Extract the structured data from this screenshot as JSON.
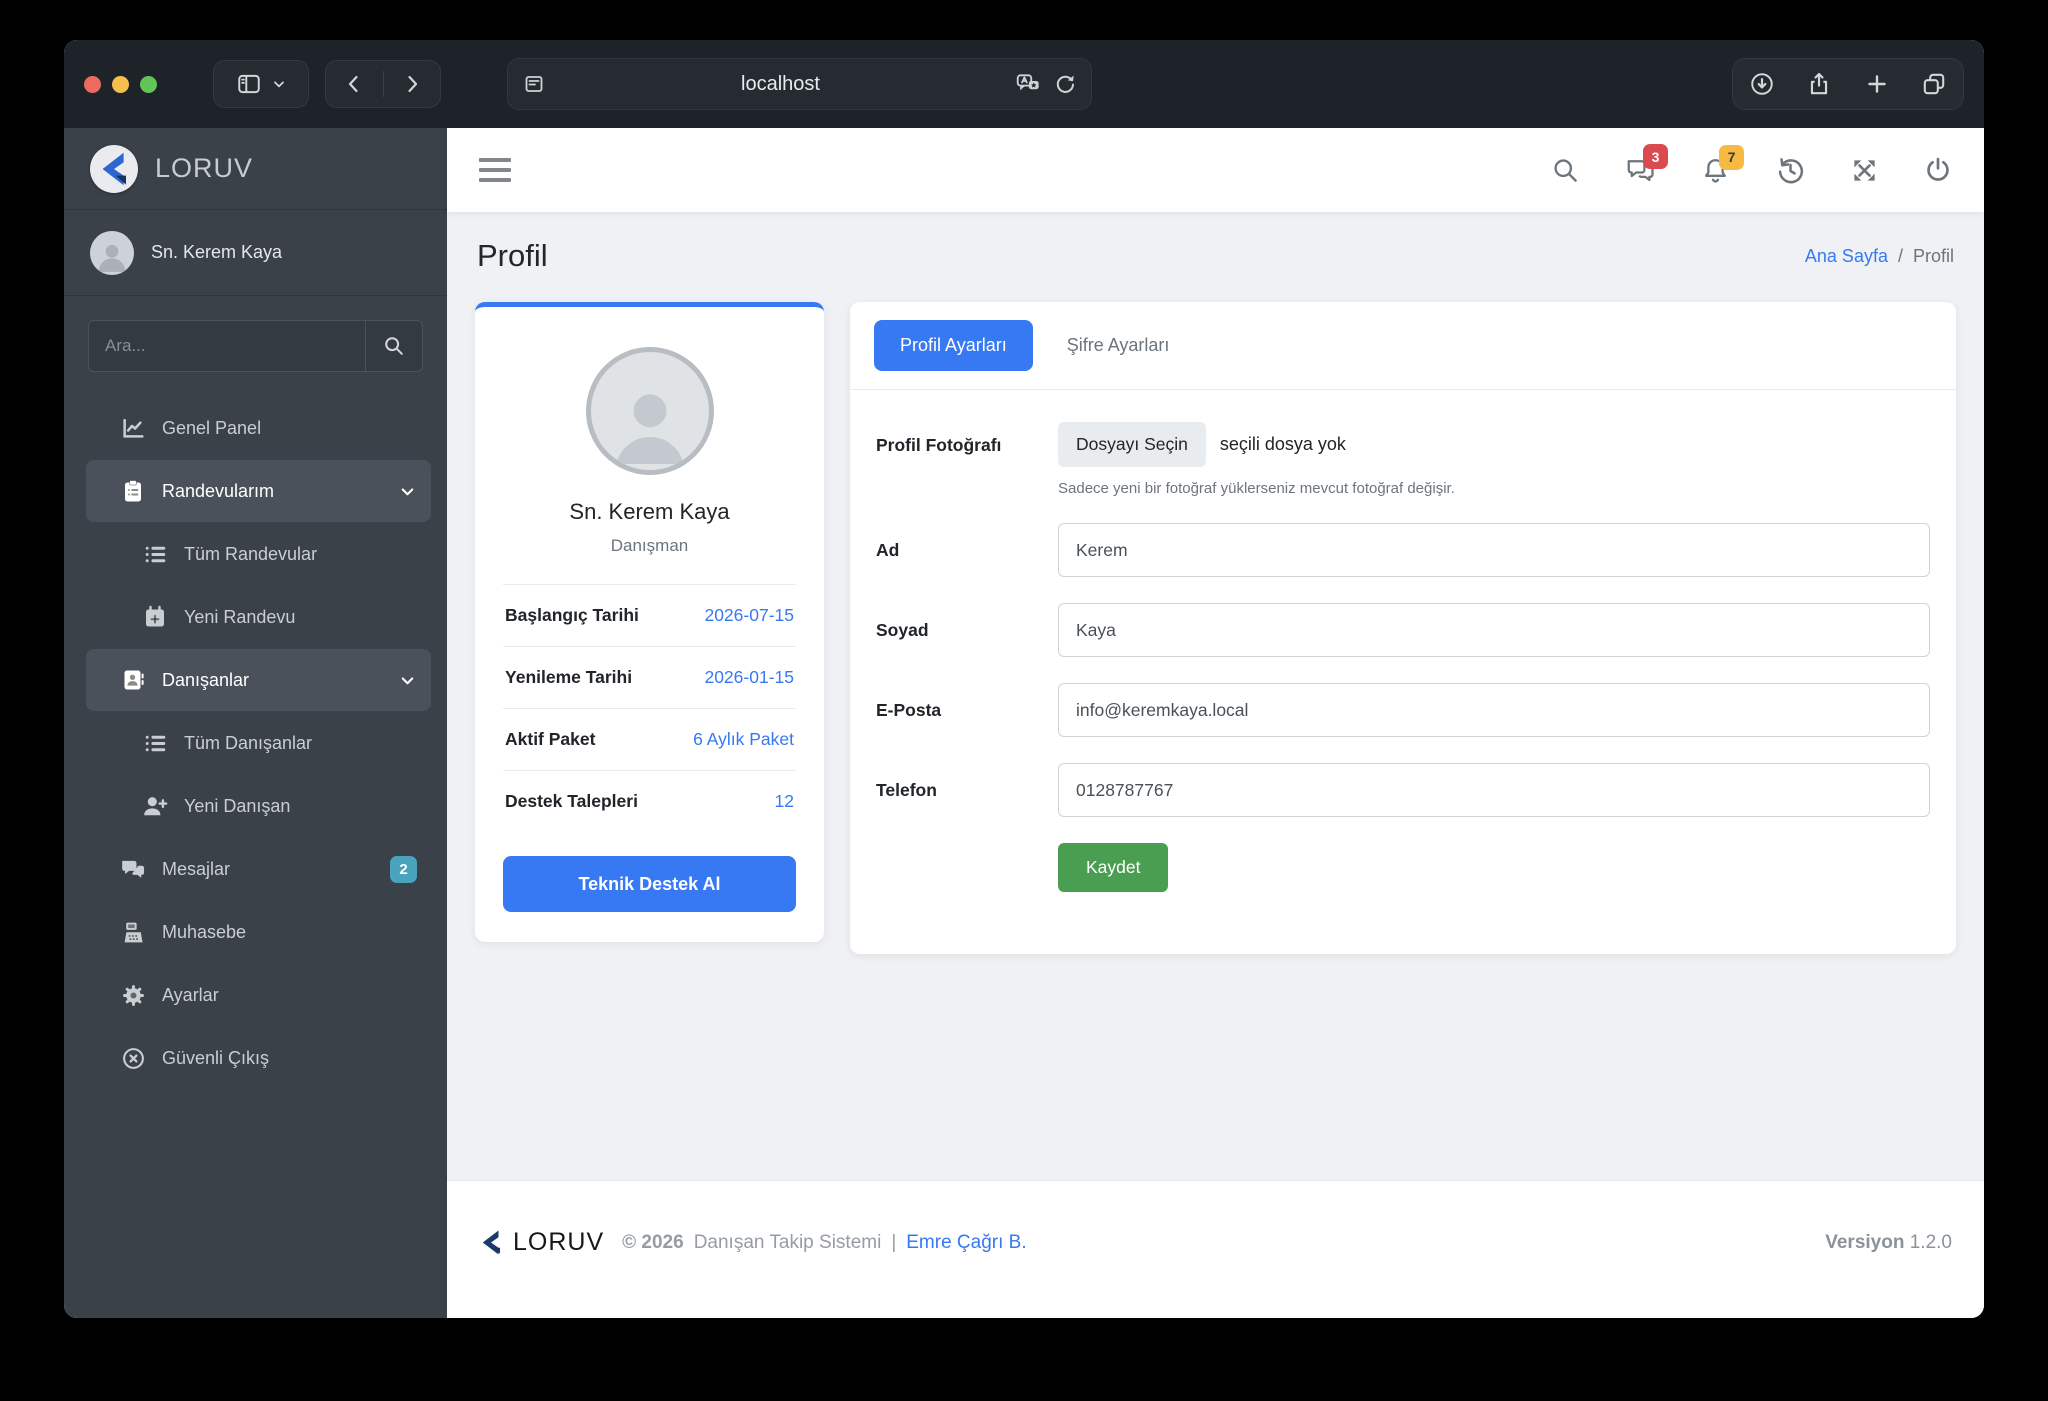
{
  "browser": {
    "url": "localhost"
  },
  "sidebar": {
    "brand": "LORUV",
    "user_name": "Sn. Kerem Kaya",
    "search_placeholder": "Ara...",
    "items": [
      {
        "label": "Genel Panel"
      },
      {
        "label": "Randevularım",
        "expanded": true
      },
      {
        "label": "Tüm Randevular",
        "sub": true
      },
      {
        "label": "Yeni Randevu",
        "sub": true
      },
      {
        "label": "Danışanlar",
        "expanded": true
      },
      {
        "label": "Tüm Danışanlar",
        "sub": true
      },
      {
        "label": "Yeni Danışan",
        "sub": true
      },
      {
        "label": "Mesajlar",
        "badge": "2"
      },
      {
        "label": "Muhasebe"
      },
      {
        "label": "Ayarlar"
      },
      {
        "label": "Güvenli Çıkış"
      }
    ]
  },
  "topbar": {
    "chat_badge": "3",
    "bell_badge": "7"
  },
  "page": {
    "title": "Profil",
    "breadcrumb_home": "Ana Sayfa",
    "breadcrumb_sep": "/",
    "breadcrumb_current": "Profil"
  },
  "profile_card": {
    "name": "Sn. Kerem Kaya",
    "role": "Danışman",
    "rows": [
      {
        "label": "Başlangıç Tarihi",
        "value": "2026-07-15"
      },
      {
        "label": "Yenileme Tarihi",
        "value": "2026-01-15"
      },
      {
        "label": "Aktif Paket",
        "value": "6 Aylık Paket"
      },
      {
        "label": "Destek Talepleri",
        "value": "12"
      }
    ],
    "support_button": "Teknik Destek Al"
  },
  "settings_card": {
    "tab_profile": "Profil Ayarları",
    "tab_password": "Şifre Ayarları",
    "photo_label": "Profil Fotoğrafı",
    "photo_button": "Dosyayı Seçin",
    "photo_status": "seçili dosya yok",
    "photo_help": "Sadece yeni bir fotoğraf yüklerseniz mevcut fotoğraf değişir.",
    "fields": [
      {
        "label": "Ad",
        "value": "Kerem"
      },
      {
        "label": "Soyad",
        "value": "Kaya"
      },
      {
        "label": "E-Posta",
        "value": "info@keremkaya.local"
      },
      {
        "label": "Telefon",
        "value": "0128787767"
      }
    ],
    "save_button": "Kaydet"
  },
  "footer": {
    "brand": "LORUV",
    "copyright": "© 2026",
    "system": "Danışan Takip Sistemi",
    "sep": "|",
    "author": "Emre Çağrı B.",
    "version_label": "Versiyon",
    "version": "1.2.0"
  },
  "colors": {
    "accent_blue": "#3778f3",
    "success_green": "#4a9e52",
    "badge_red": "#da4b51",
    "badge_yellow": "#f6ba42",
    "badge_teal": "#4aa3bc",
    "sidebar_bg": "#3a4149",
    "chrome_bg": "#1e232a",
    "content_bg": "#eff1f4"
  }
}
